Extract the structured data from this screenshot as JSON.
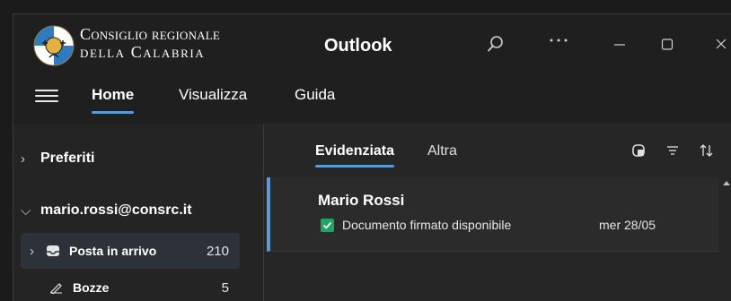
{
  "titlebar": {
    "org_line1": "Consiglio regionale",
    "org_line2": "della Calabria",
    "app_title": "Outlook",
    "icons": {
      "search": "search-icon",
      "more": "more-icon",
      "minimize": "minimize-icon",
      "maximize": "maximize-icon",
      "close": "close-icon"
    }
  },
  "ribbon": {
    "tabs": [
      {
        "label": "Home",
        "selected": true
      },
      {
        "label": "Visualizza",
        "selected": false
      },
      {
        "label": "Guida",
        "selected": false
      }
    ]
  },
  "folders": {
    "favorites_label": "Preferiti",
    "account_label": "mario.rossi@consrc.it",
    "items": [
      {
        "label": "Posta in arrivo",
        "count": "210",
        "icon": "inbox-icon",
        "selected": true
      },
      {
        "label": "Bozze",
        "count": "5",
        "icon": "drafts-icon",
        "selected": false
      }
    ]
  },
  "message_list": {
    "pivots": [
      {
        "label": "Evidenziata",
        "selected": true
      },
      {
        "label": "Altra",
        "selected": false
      }
    ],
    "messages": [
      {
        "sender": "Mario Rossi",
        "subject": "Documento firmato disponibile",
        "date": "mer 28/05",
        "category_color": "#21a366"
      }
    ]
  },
  "colors": {
    "accent": "#5b9bd5",
    "background": "#202020"
  }
}
